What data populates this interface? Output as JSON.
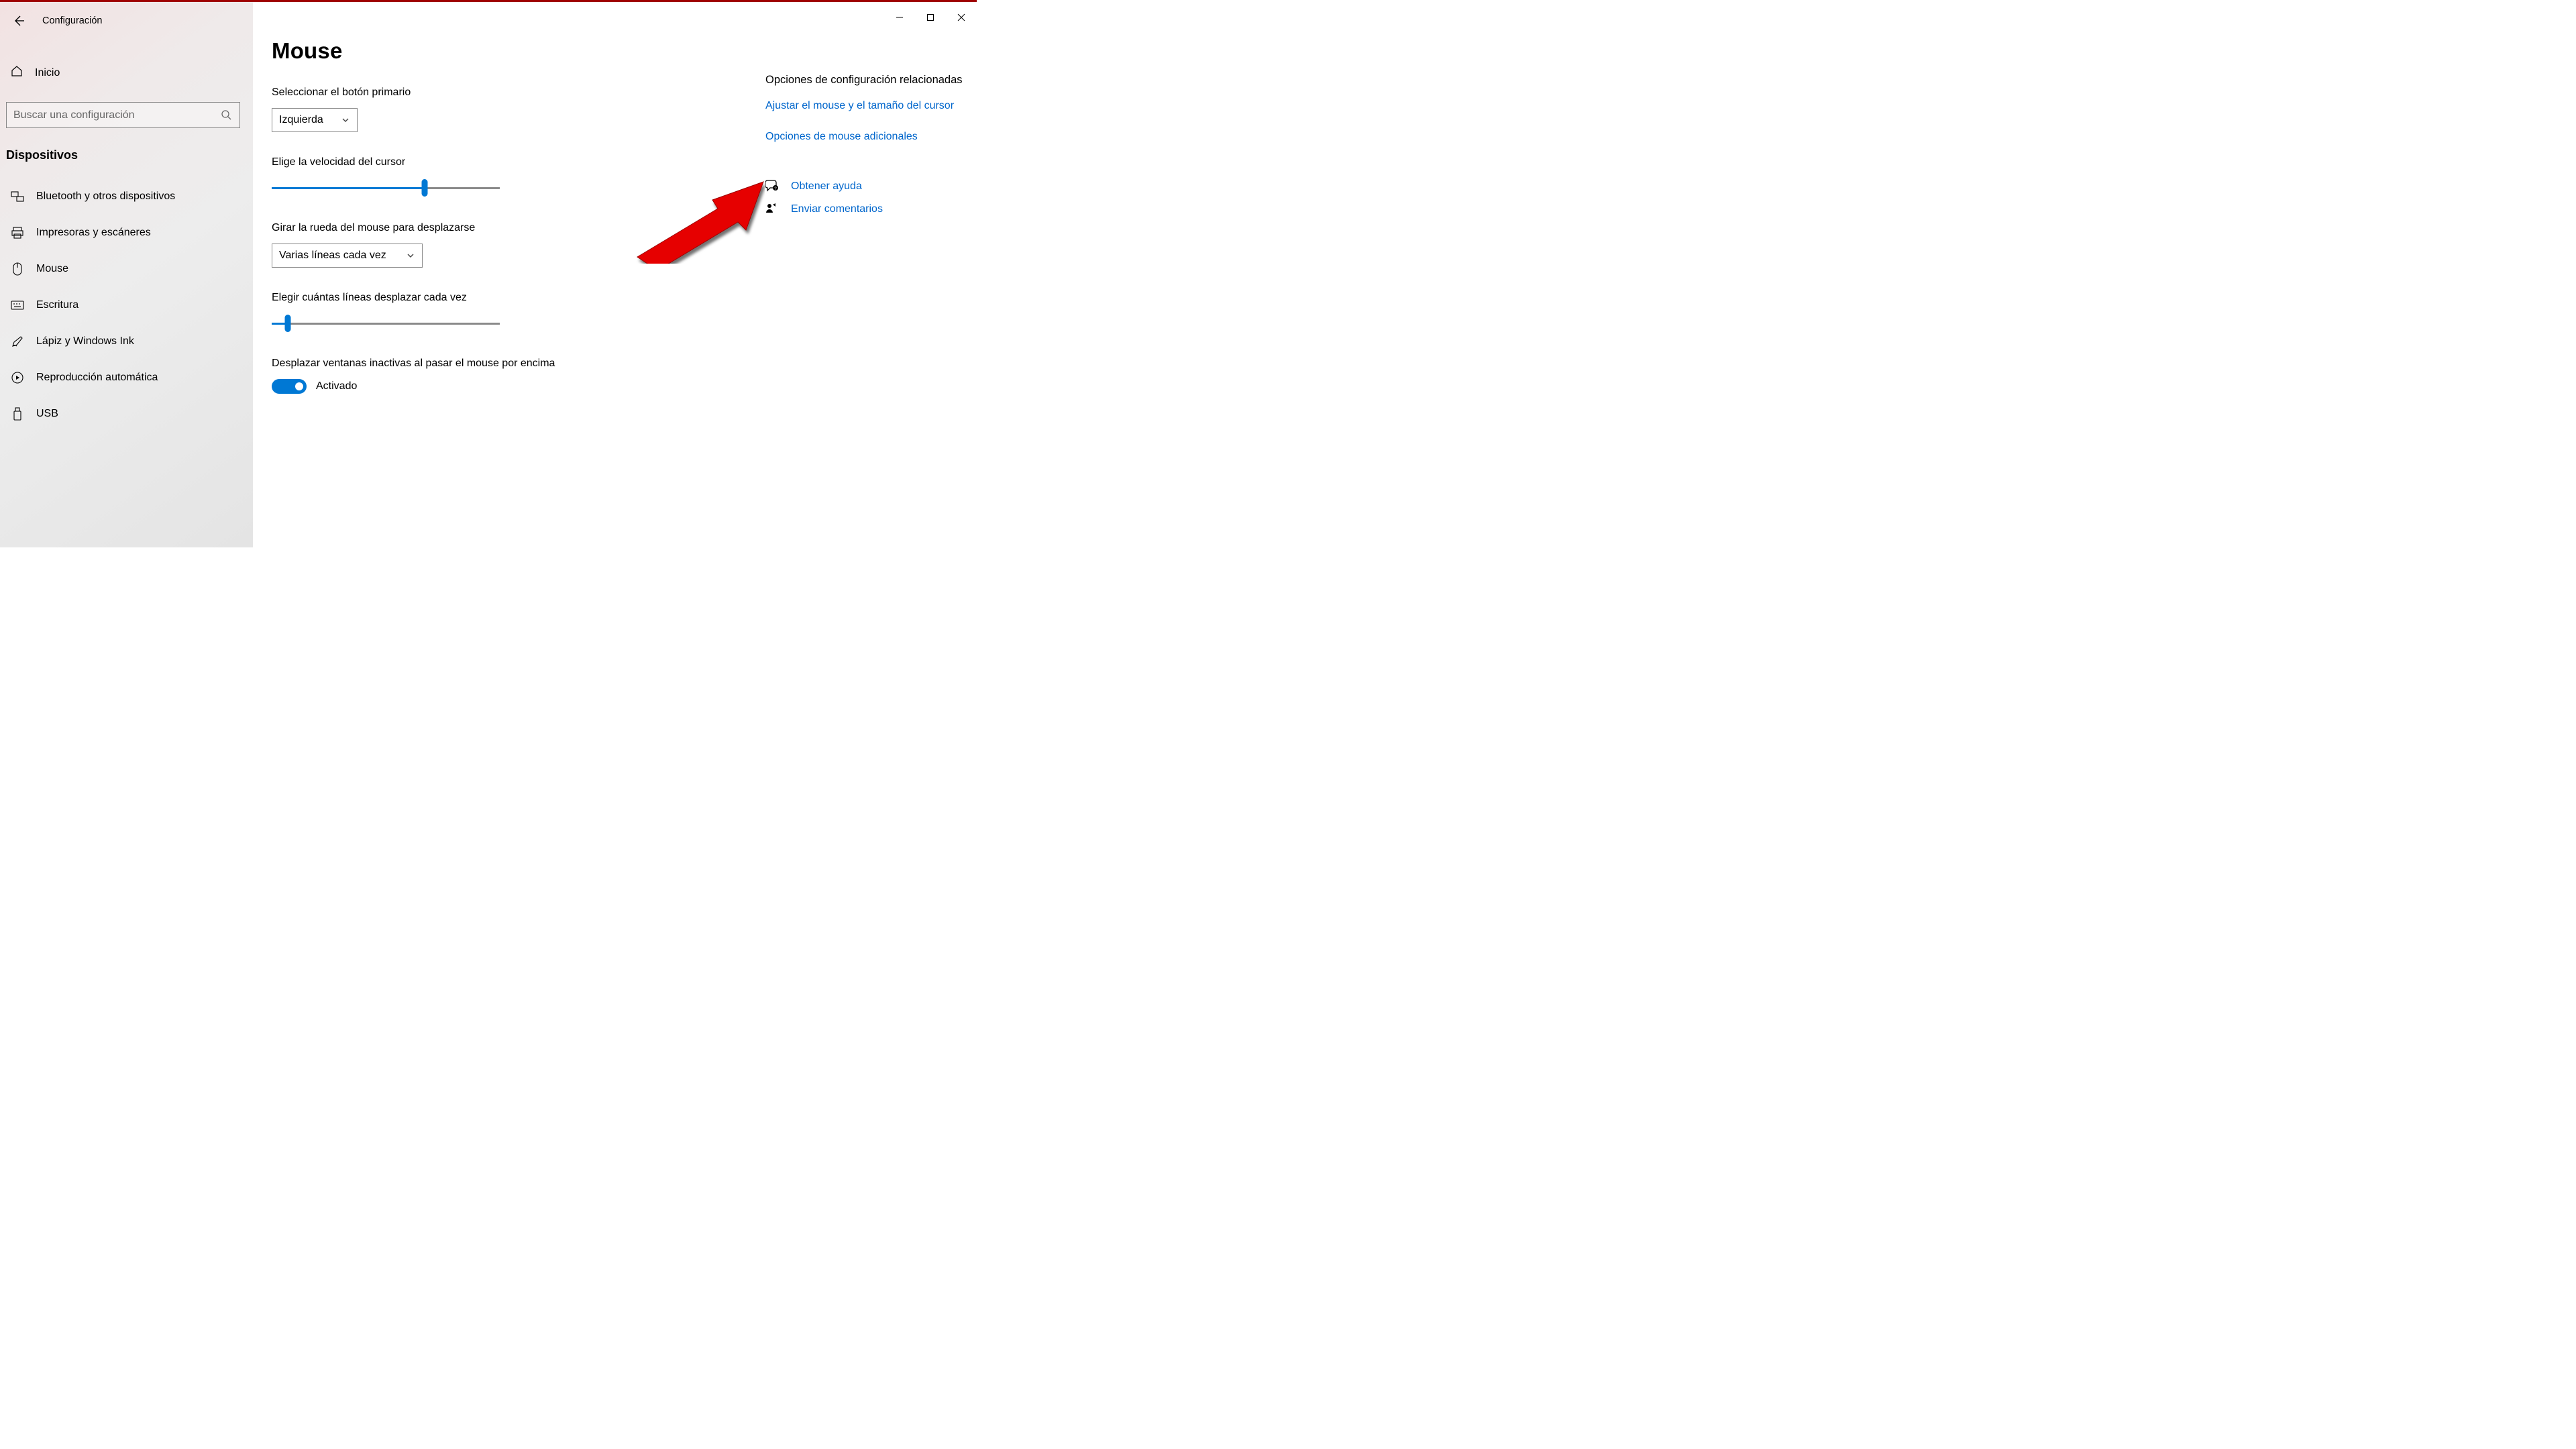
{
  "app_title": "Configuración",
  "window_controls": {
    "min": "–",
    "max": "▢",
    "close": "✕"
  },
  "sidebar": {
    "home_label": "Inicio",
    "search_placeholder": "Buscar una configuración",
    "category": "Dispositivos",
    "items": [
      {
        "label": "Bluetooth y otros dispositivos",
        "icon": "bluetooth-devices-icon"
      },
      {
        "label": "Impresoras y escáneres",
        "icon": "printer-icon"
      },
      {
        "label": "Mouse",
        "icon": "mouse-icon"
      },
      {
        "label": "Escritura",
        "icon": "keyboard-icon"
      },
      {
        "label": "Lápiz y Windows Ink",
        "icon": "pen-icon"
      },
      {
        "label": "Reproducción automática",
        "icon": "autoplay-icon"
      },
      {
        "label": "USB",
        "icon": "usb-icon"
      }
    ]
  },
  "main": {
    "title": "Mouse",
    "primary_button": {
      "label": "Seleccionar el botón primario",
      "value": "Izquierda"
    },
    "cursor_speed": {
      "label": "Elige la velocidad del cursor",
      "value_pct": 67
    },
    "wheel_scroll": {
      "label": "Girar la rueda del mouse para desplazarse",
      "value": "Varias líneas cada vez"
    },
    "lines_per_scroll": {
      "label": "Elegir cuántas líneas desplazar cada vez",
      "value_pct": 7
    },
    "inactive_scroll": {
      "label": "Desplazar ventanas inactivas al pasar el mouse por encima",
      "state_label": "Activado",
      "on": true
    }
  },
  "right_panel": {
    "related_heading": "Opciones de configuración relacionadas",
    "links": [
      "Ajustar el mouse y el tamaño del cursor",
      "Opciones de mouse adicionales"
    ],
    "support": [
      {
        "label": "Obtener ayuda",
        "icon": "help-icon"
      },
      {
        "label": "Enviar comentarios",
        "icon": "feedback-icon"
      }
    ]
  },
  "colors": {
    "accent": "#0078d4",
    "link": "#0066cc",
    "sidebar_bg": "#ededed",
    "arrow": "#e60000"
  }
}
